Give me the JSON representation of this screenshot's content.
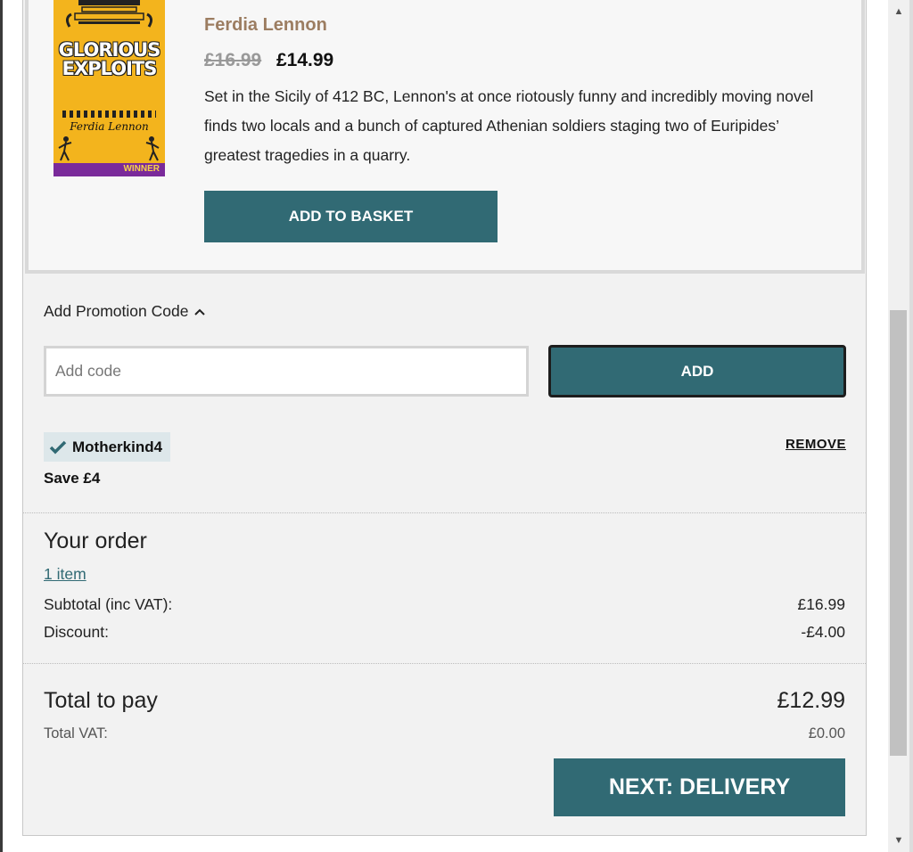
{
  "product": {
    "cover_title_line1": "GLORIOUS",
    "cover_title_line2": "EXPLOITS",
    "cover_author": "Ferdia Lennon",
    "cover_badge": "WINNER",
    "author": "Ferdia Lennon",
    "price_original": "£16.99",
    "price_sale": "£14.99",
    "description": "Set in the Sicily of 412 BC, Lennon's at once riotously funny and incredibly moving novel finds two locals and a bunch of captured Athenian soldiers staging two of Euripides’ greatest tragedies in a quarry.",
    "add_to_basket_label": "ADD TO BASKET"
  },
  "promo": {
    "toggle_label": "Add Promotion Code",
    "input_placeholder": "Add code",
    "input_value": "",
    "add_label": "ADD",
    "applied_code": "Motherkind4",
    "remove_label": "REMOVE",
    "save_text": "Save £4"
  },
  "order": {
    "title": "Your order",
    "items_link": "1 item",
    "subtotal_label": "Subtotal (inc VAT):",
    "subtotal_value": "£16.99",
    "discount_label": "Discount:",
    "discount_value": "-£4.00",
    "total_label": "Total to pay",
    "total_value": "£12.99",
    "vat_label": "Total VAT:",
    "vat_value": "£0.00",
    "next_label": "NEXT: DELIVERY"
  },
  "colors": {
    "primary_button": "#316a74",
    "author_text": "#9c7d61",
    "applied_tag_bg": "#dde7ea"
  },
  "icons": {
    "promo_toggle": "chevron-up-icon",
    "applied": "check-icon",
    "scroll_up": "triangle-up",
    "scroll_down": "triangle-down"
  }
}
